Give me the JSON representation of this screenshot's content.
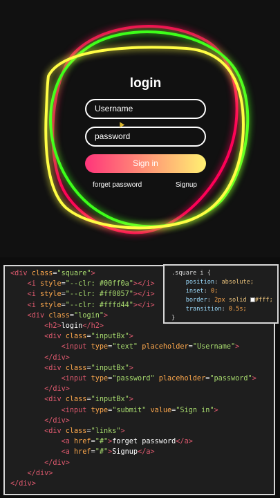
{
  "login": {
    "title": "login",
    "username_placeholder": "Username",
    "password_placeholder": "password",
    "submit_label": "Sign in",
    "link_forgot": "forget password",
    "link_signup": "Signup"
  },
  "colors": {
    "red": "#ff0057",
    "green": "#00ff0a",
    "yellow": "#fffd44"
  },
  "html_code": [
    "<div class=\"square\">",
    "    <i style=\"--clr: #00ff0a\"></i>",
    "    <i style=\"--clr: #ff0057\"></i>",
    "    <i style=\"--clr: #fffd44\"></i>",
    "    <div class=\"login\">",
    "        <h2>login</h2>",
    "        <div class=\"inputBx\">",
    "            <input type=\"text\" placeholder=\"Username\">",
    "        </div>",
    "        <div class=\"inputBx\">",
    "            <input type=\"password\" placeholder=\"password\">",
    "        </div>",
    "        <div class=\"inputBx\">",
    "            <input type=\"submit\" value=\"Sign in\">",
    "        </div>",
    "        <div class=\"links\">",
    "            <a href=\"#\">forget password</a>",
    "            <a href=\"#\">Signup</a>",
    "        </div>",
    "    </div>",
    "</div>"
  ],
  "css_code": [
    ".square i {",
    "    position: absolute;",
    "    inset: 0;",
    "    border: 2px solid #fff;",
    "    transition: 0.5s;",
    "}"
  ]
}
